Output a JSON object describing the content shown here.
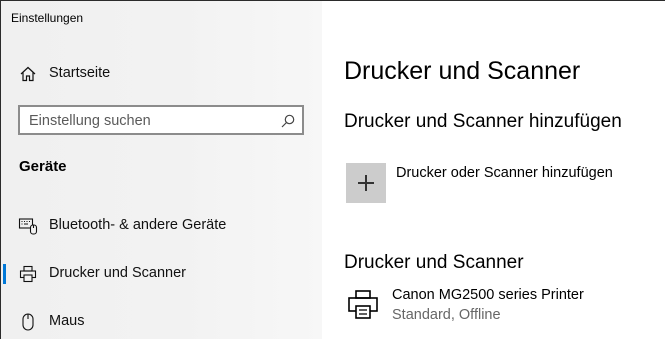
{
  "window": {
    "title": "Einstellungen"
  },
  "sidebar": {
    "home_label": "Startseite",
    "search": {
      "placeholder": "Einstellung suchen",
      "value": ""
    },
    "section_title": "Geräte",
    "items": [
      {
        "label": "Bluetooth- & andere Geräte",
        "icon": "bluetooth-devices-icon"
      },
      {
        "label": "Drucker und Scanner",
        "icon": "printer-icon",
        "selected": true
      },
      {
        "label": "Maus",
        "icon": "mouse-icon"
      }
    ]
  },
  "main": {
    "title": "Drucker und Scanner",
    "add_section_title": "Drucker und Scanner hinzufügen",
    "add_button_label": "Drucker oder Scanner hinzufügen",
    "list_section_title": "Drucker und Scanner",
    "printers": [
      {
        "name": "Canon MG2500 series Printer",
        "status": "Standard, Offline",
        "icon": "printer-icon"
      }
    ]
  },
  "colors": {
    "accent": "#0078d7",
    "sidebar_bg": "#f2f2f2",
    "tile_bg": "#cccccc"
  }
}
